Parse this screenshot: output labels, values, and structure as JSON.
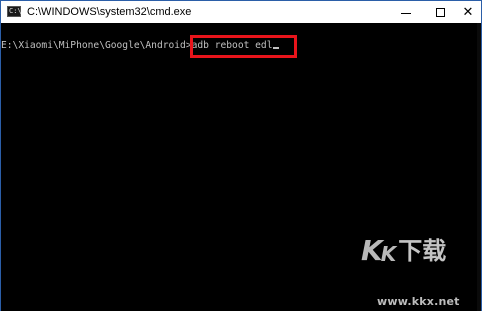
{
  "window": {
    "title": "C:\\WINDOWS\\system32\\cmd.exe",
    "icon": "cmd-app-icon",
    "controls": {
      "minimize": "minimize-icon",
      "maximize": "maximize-icon",
      "close": "close-icon"
    }
  },
  "console": {
    "prompt": "E:\\Xiaomi\\MiPhone\\Google\\Android>",
    "command": "adb reboot edl",
    "highlight_color": "#e8141b",
    "text_color": "#c0c0c0",
    "background": "#000000"
  },
  "watermark": {
    "logo": "KK下载",
    "url": "www.kkx.net"
  }
}
